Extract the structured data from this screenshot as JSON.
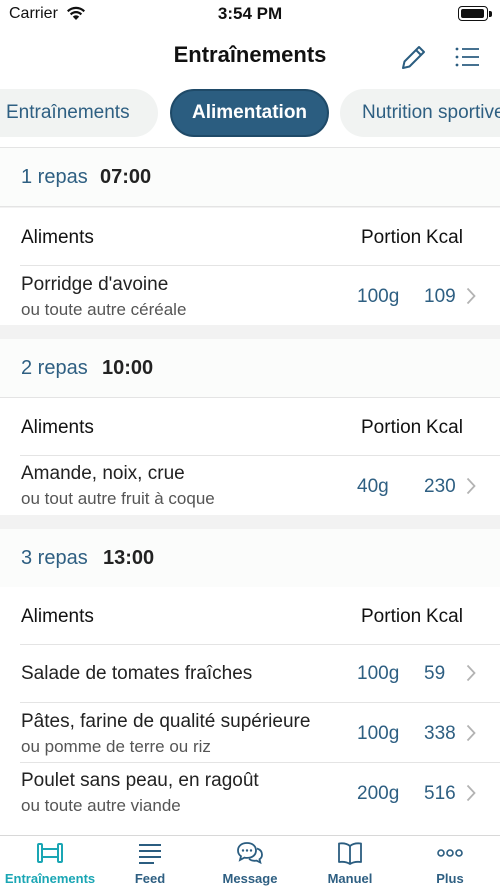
{
  "status_bar": {
    "carrier": "Carrier",
    "time": "3:54 PM"
  },
  "nav": {
    "title": "Entraînements"
  },
  "tabs": [
    {
      "label": "Entraînements",
      "active": false
    },
    {
      "label": "Alimentation",
      "active": true
    },
    {
      "label": "Nutrition sportive",
      "active": false
    }
  ],
  "columns": {
    "aliments": "Aliments",
    "portion": "Portion",
    "kcal": "Kcal"
  },
  "meals": [
    {
      "label": "1 repas",
      "time": "07:00",
      "foods": [
        {
          "name": "Porridge d'avoine",
          "alt": "ou toute autre céréale",
          "portion": "100g",
          "kcal": "109"
        }
      ]
    },
    {
      "label": "2 repas",
      "time": "10:00",
      "foods": [
        {
          "name": "Amande, noix, crue",
          "alt": "ou tout autre fruit à coque",
          "portion": "40g",
          "kcal": "230"
        }
      ]
    },
    {
      "label": "3 repas",
      "time": "13:00",
      "foods": [
        {
          "name": "Salade de tomates fraîches",
          "alt": "",
          "portion": "100g",
          "kcal": "59"
        },
        {
          "name": "Pâtes, farine de qualité supérieure",
          "alt": "ou pomme de terre ou riz",
          "portion": "100g",
          "kcal": "338"
        },
        {
          "name": "Poulet sans peau, en ragoût",
          "alt": "ou toute autre viande",
          "portion": "200g",
          "kcal": "516"
        }
      ]
    }
  ],
  "tab_bar": [
    {
      "label": "Entraînements",
      "icon": "dumbbell-icon",
      "active": true
    },
    {
      "label": "Feed",
      "icon": "feed-lines-icon",
      "active": false
    },
    {
      "label": "Message",
      "icon": "chat-bubbles-icon",
      "active": false
    },
    {
      "label": "Manuel",
      "icon": "book-icon",
      "active": false
    },
    {
      "label": "Plus",
      "icon": "more-dots-icon",
      "active": false
    }
  ],
  "colors": {
    "accent": "#2b5d80",
    "active_tab_item": "#1aa6b4",
    "link_text": "#2e5f82"
  }
}
